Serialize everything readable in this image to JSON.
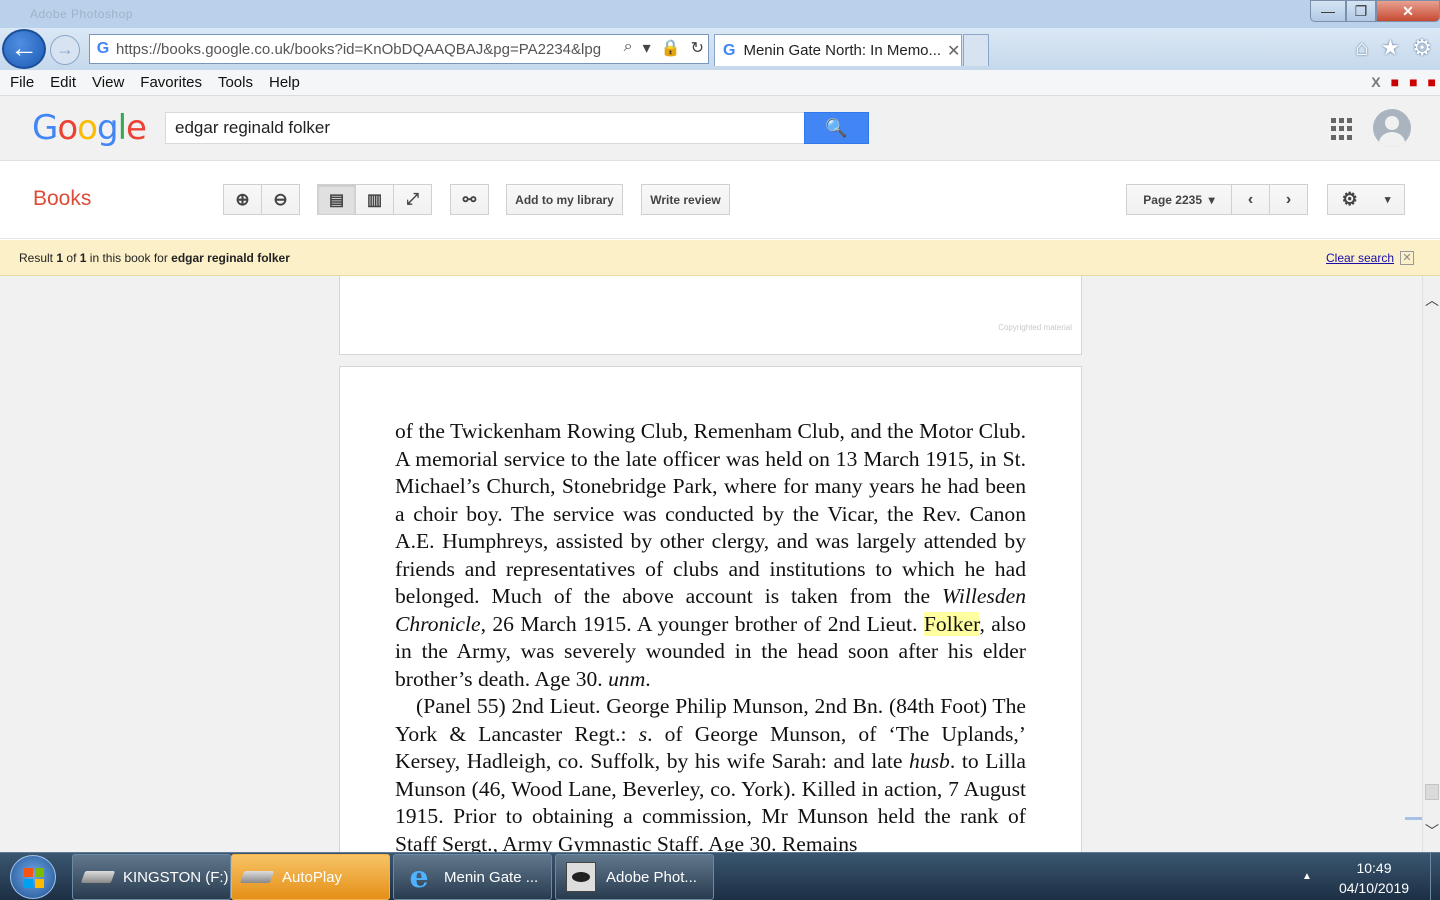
{
  "window": {
    "titlebar_ghost": "Adobe Photoshop",
    "minimize_glyph": "—",
    "maximize_glyph": "❐",
    "close_glyph": "✕"
  },
  "browser": {
    "url": "https://books.google.co.uk/books?id=KnObDQAAQBAJ&pg=PA2234&lpg",
    "tab_title": "Menin Gate North: In Memo...",
    "tab_close_glyph": "✕",
    "back_glyph": "←",
    "forward_glyph": "→",
    "addr_icons": [
      "search-icon",
      "dropdown-icon",
      "lock-icon",
      "refresh-icon"
    ],
    "addr_glyphs": {
      "search": "⌕",
      "dropdown": "▾",
      "lock": "🔒",
      "refresh": "↻"
    },
    "right_icons": {
      "home": "⌂",
      "favorites": "★",
      "settings": "⚙"
    }
  },
  "menubar": {
    "items": [
      "File",
      "Edit",
      "View",
      "Favorites",
      "Tools",
      "Help"
    ],
    "close_glyph": "X"
  },
  "google": {
    "logo": {
      "g1": "G",
      "o1": "o",
      "o2": "o",
      "g2": "g",
      "l": "l",
      "e": "e"
    },
    "search_value": "edgar reginald folker",
    "search_glyph": "🔍"
  },
  "books": {
    "label": "Books",
    "zoom_in_glyph": "⊕",
    "zoom_out_glyph": "⊖",
    "single_glyph": "▤",
    "double_glyph": "▥",
    "full_glyph": "⤢",
    "link_glyph": "⚯",
    "add_library": "Add to my library",
    "write_review": "Write review",
    "page_label": "Page 2235",
    "page_caret": "▾",
    "prev_glyph": "‹",
    "next_glyph": "›",
    "settings_glyph": "⚙",
    "settings_caret": "▾"
  },
  "result_bar": {
    "prefix": "Result",
    "current": "1",
    "of": "of",
    "total": "1",
    "mid": "in this book for",
    "query": "edgar reginald folker",
    "clear": "Clear search",
    "clear_x": "✕"
  },
  "viewer": {
    "copyright": "Copyrighted material",
    "p1_a": "of the Twickenham Rowing Club, Remenham Club, and the Motor Club. A memorial service to the late officer was held on 13 March 1915, in St. Michael’s Church, Stonebridge Park, where for many years he had been a choir boy. The service was conducted by the Vicar, the Rev. Canon A.E. Humphreys, assisted by other clergy, and was largely attended by friends and representatives of clubs and institutions to which he had belonged. Much of the above account is taken from the ",
    "p1_italic": "Willesden Chronicle",
    "p1_b": ", 26 March 1915. A younger brother of 2nd Lieut. ",
    "p1_highlight": "Folker",
    "p1_c": ", also in the Army, was severely wounded in the head soon after his elder brother’s death. Age 30. ",
    "p1_unm": "unm",
    "p1_end": ".",
    "p2_a": "(Panel 55) 2nd Lieut. George Philip Munson, 2nd Bn. (84th Foot) The York & Lancaster Regt.: ",
    "p2_s": "s",
    "p2_b": ". of George Munson, of ‘The Uplands,’ Kersey, Hadleigh, co. Suffolk, by his wife Sarah: and late ",
    "p2_husb": "husb",
    "p2_c": ". to Lilla Munson (46, Wood Lane, Beverley, co. York). Killed in action, 7 August 1915. Prior to obtaining a commission, Mr Munson held the rank of Staff Sergt., Army Gymnastic Staff. Age 30. Remains"
  },
  "scrollbar": {
    "up": "︿",
    "down": "﹀"
  },
  "taskbar": {
    "items": [
      "KINGSTON (F:)",
      "AutoPlay",
      "Menin Gate ...",
      "Adobe Phot..."
    ],
    "ie_glyph": "e",
    "tray_arrow": "▲",
    "time": "10:49",
    "date": "04/10/2019"
  }
}
